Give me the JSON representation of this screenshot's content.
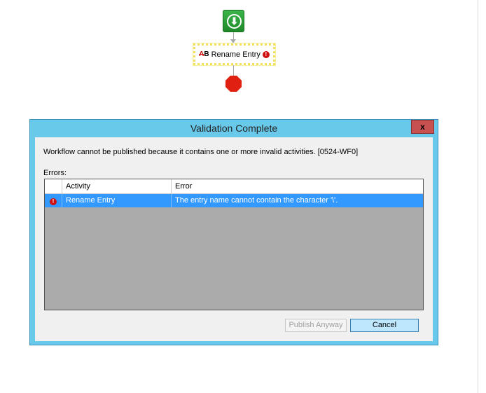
{
  "workflow": {
    "activity_label": "Rename Entry",
    "activity_icon": "AB"
  },
  "dialog": {
    "title": "Validation Complete",
    "close_label": "x",
    "message": "Workflow cannot be published because it contains one or more invalid activities. [0524-WF0]",
    "errors_label": "Errors:",
    "columns": [
      "",
      "Activity",
      "Error"
    ],
    "rows": [
      {
        "activity": "Rename Entry",
        "error": "The entry name cannot contain the character '\\'."
      }
    ],
    "publish_label": "Publish Anyway",
    "cancel_label": "Cancel"
  },
  "colors": {
    "titlebar": "#68c9ea",
    "selection": "#3399ff",
    "close": "#c75050"
  }
}
